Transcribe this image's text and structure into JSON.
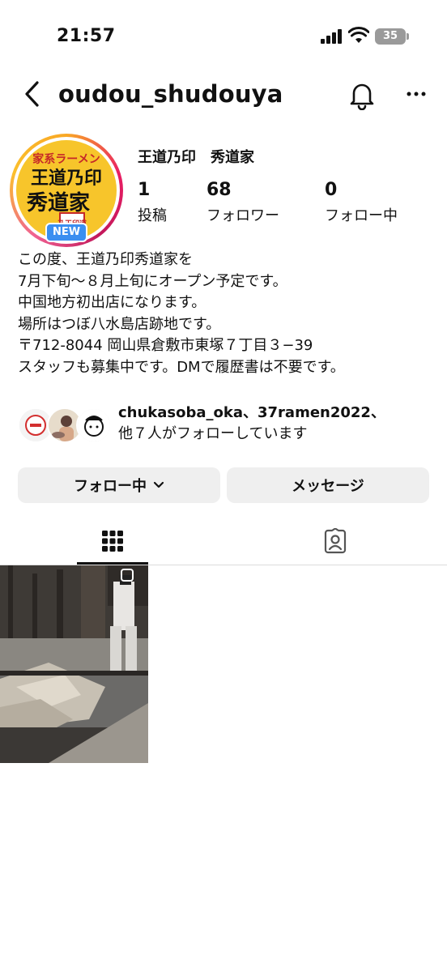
{
  "status_bar": {
    "time": "21:57",
    "battery": "35"
  },
  "header": {
    "username": "oudou_shudouya"
  },
  "avatar": {
    "line1": "家系ラーメン",
    "line2": "王道乃印",
    "line3": "秀道家",
    "stamp": "乃王印道",
    "badge": "NEW"
  },
  "profile": {
    "display_name": "王道乃印　秀道家"
  },
  "stats": [
    {
      "value": "1",
      "label": "投稿"
    },
    {
      "value": "68",
      "label": "フォロワー"
    },
    {
      "value": "0",
      "label": "フォロー中"
    }
  ],
  "bio": [
    "この度、王道乃印秀道家を",
    "7月下旬〜８月上旬にオープン予定です。",
    "中国地方初出店になります。",
    "場所はつぼ八水島店跡地です。",
    "〒712-8044 岡山県倉敷市東塚７丁目３−39",
    "スタッフも募集中です。DMで履歴書は不要です。"
  ],
  "followed_by": {
    "names": "chukasoba_oka、37ramen2022、",
    "rest": "他７人がフォローしています"
  },
  "buttons": {
    "following": "フォロー中",
    "message": "メッセージ"
  },
  "colors": {
    "accent": "#3b8ef0",
    "button_bg": "#efefef",
    "avatar_bg": "#f7c52b",
    "avatar_red": "#c62828"
  }
}
